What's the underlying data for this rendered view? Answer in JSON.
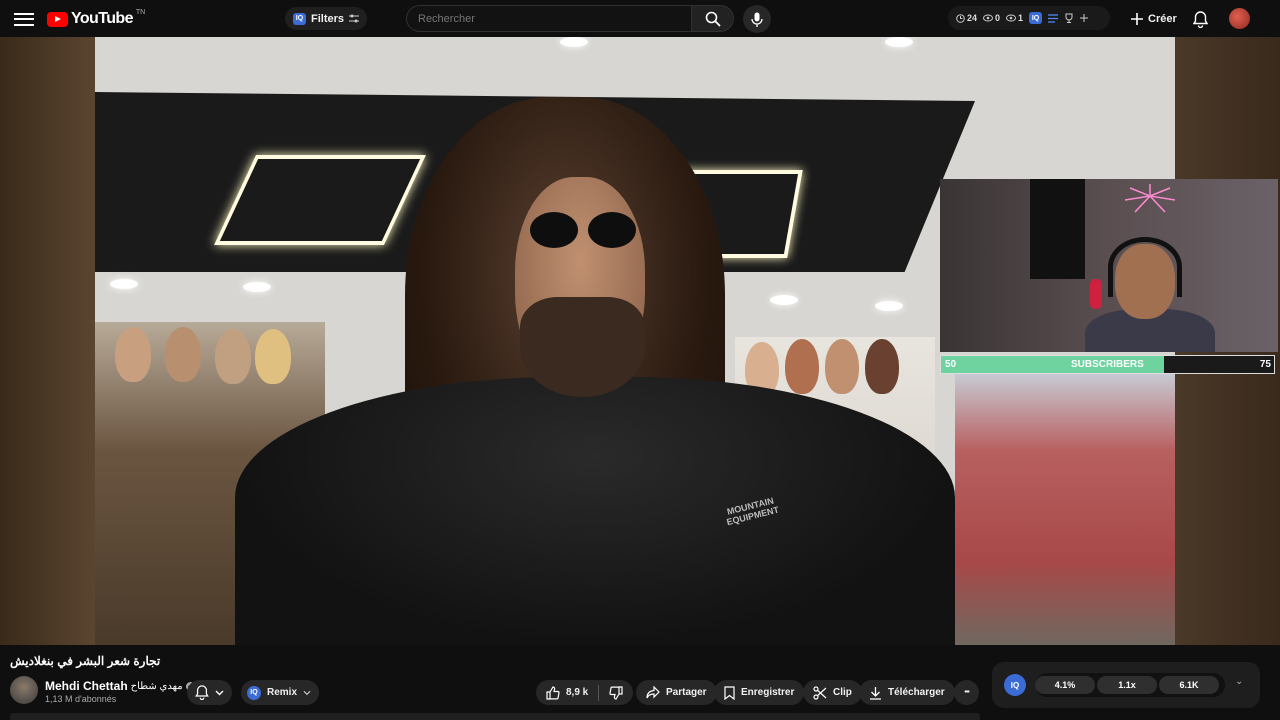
{
  "header": {
    "logo_text": "YouTube",
    "logo_tm": "TN",
    "filters_label": "Filters",
    "filters_badge": "IQ",
    "search_placeholder": "Rechercher",
    "stats": {
      "watch_time": "24",
      "views_a": "0",
      "views_b": "1"
    },
    "stats_badge": "IQ",
    "create_label": "Créer"
  },
  "video": {
    "jacket_text": "MOUNTAIN\nEQUIPMENT"
  },
  "overlay": {
    "subscribers_label": "SUBSCRIBERS",
    "subscribers_min": "50",
    "subscribers_max": "75",
    "progress_fraction": 0.67
  },
  "info": {
    "title": "تجارة شعر البشر في بنغلاديش",
    "channel_name": "Mehdi Chettah",
    "channel_name_ar": "مهدي شطاح",
    "verified_mark": "✓",
    "subscribers": "1,13 M d'abonnés",
    "remix_badge": "IQ",
    "remix_label": "Remix",
    "like_count": "8,9 k",
    "share_label": "Partager",
    "save_label": "Enregistrer",
    "clip_label": "Clip",
    "download_label": "Télécharger",
    "more_label": "•••"
  },
  "extension": {
    "badge": "IQ",
    "values": [
      "4.1%",
      "1.1x",
      "6.1K"
    ],
    "chevron": "⌄"
  },
  "colors": {
    "accent_red": "#ff0000",
    "iq_blue": "#3b6bd4",
    "subscribers_fill": "#6fd3a0"
  }
}
